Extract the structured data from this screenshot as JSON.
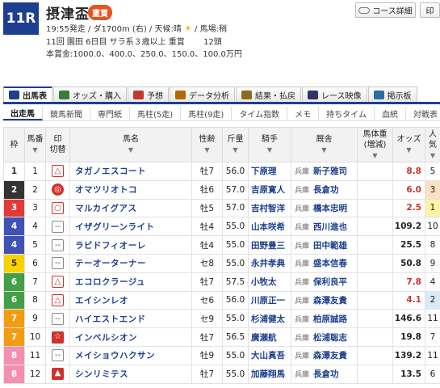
{
  "race": {
    "number": "11R",
    "name": "摂津盃",
    "grade": "重賞",
    "line1": "19:55発走 / ダ1700m (右) / 天候:晴 ",
    "weather_icon": "sun-icon",
    "line1b": " / 馬場:稍",
    "line2": "11回 園田 6日目 サラ系３歳以上 重賞 　　12頭",
    "line3": "本賞金:1000.0、400.0、250.0、150.0、100.0万円"
  },
  "buttons": {
    "course": "コース詳細",
    "print": "印"
  },
  "tabs": [
    {
      "label": "出馬表",
      "color": "#1d3f8f"
    },
    {
      "label": "オッズ・購入",
      "color": "#3a7a3a"
    },
    {
      "label": "予想",
      "color": "#c0392b"
    },
    {
      "label": "データ分析",
      "color": "#b36b00"
    },
    {
      "label": "結果・払戻",
      "color": "#8a6d1e"
    },
    {
      "label": "レース映像",
      "color": "#333366"
    },
    {
      "label": "掲示板",
      "color": "#2e6da4"
    }
  ],
  "subtabs": [
    "出走馬",
    "競馬新聞",
    "専門紙",
    "馬柱(5走)",
    "馬柱(9走)",
    "タイム指数",
    "メモ",
    "持ちタイム",
    "血統",
    "対戦表"
  ],
  "headers": {
    "waku": "枠",
    "umaban": "馬番",
    "mark": "印",
    "mark_sub": "切替",
    "horse": "馬名",
    "sex_age": "性齢",
    "weight": "斤量",
    "jockey": "騎手",
    "trainer": "厩舎",
    "body_weight": "馬体重",
    "body_weight_sub": "(増減)",
    "odds": "オッズ",
    "popularity": "人気",
    "sort_arrow": "▼"
  },
  "colors": {
    "waku1": "#ffffff",
    "waku2": "#333333",
    "waku3": "#e53935",
    "waku4": "#3f51b5",
    "waku5": "#f9d100",
    "waku6": "#43a047",
    "waku7": "#f39c12",
    "waku8": "#f48fb1"
  },
  "horses": [
    {
      "waku": "1",
      "umaban": "1",
      "mark": "△",
      "mark_type": "tri",
      "name": "タガノエスコート",
      "sex_age": "牡7",
      "weight": "56.0",
      "jockey": "下原理",
      "stable": "兵庫",
      "trainer": "新子雅司",
      "odds": "8.8",
      "odds_red": true,
      "pop": "5"
    },
    {
      "waku": "2",
      "umaban": "2",
      "mark": "◎",
      "mark_type": "dbl",
      "name": "オマツリオトコ",
      "sex_age": "牡6",
      "weight": "57.0",
      "jockey": "吉原寛人",
      "stable": "兵庫",
      "trainer": "長倉功",
      "odds": "6.0",
      "odds_red": true,
      "pop": "3"
    },
    {
      "waku": "3",
      "umaban": "3",
      "mark": "○",
      "mark_type": "circ",
      "name": "マルカイグアス",
      "sex_age": "牡5",
      "weight": "57.0",
      "jockey": "吉村智洋",
      "stable": "兵庫",
      "trainer": "橋本忠明",
      "odds": "2.5",
      "odds_red": true,
      "pop": "1"
    },
    {
      "waku": "4",
      "umaban": "4",
      "mark": "--",
      "mark_type": "dash",
      "name": "イザグリーンライト",
      "sex_age": "牡4",
      "weight": "55.0",
      "jockey": "山本咲希",
      "stable": "兵庫",
      "trainer": "西川進也",
      "odds": "109.2",
      "odds_red": false,
      "pop": "10"
    },
    {
      "waku": "4",
      "umaban": "5",
      "mark": "--",
      "mark_type": "dash",
      "name": "ラビドフィオーレ",
      "sex_age": "牡4",
      "weight": "55.0",
      "jockey": "田野豊三",
      "stable": "兵庫",
      "trainer": "田中範雄",
      "odds": "25.5",
      "odds_red": false,
      "pop": "8"
    },
    {
      "waku": "5",
      "umaban": "6",
      "mark": "--",
      "mark_type": "dash",
      "name": "テーオーターナー",
      "sex_age": "セ8",
      "weight": "55.0",
      "jockey": "永井孝典",
      "stable": "兵庫",
      "trainer": "盛本信春",
      "odds": "50.8",
      "odds_red": false,
      "pop": "9"
    },
    {
      "waku": "6",
      "umaban": "7",
      "mark": "△",
      "mark_type": "tri",
      "name": "エコロクラージュ",
      "sex_age": "牡7",
      "weight": "57.5",
      "jockey": "小牧太",
      "stable": "兵庫",
      "trainer": "保利良平",
      "odds": "7.8",
      "odds_red": true,
      "pop": "4"
    },
    {
      "waku": "6",
      "umaban": "8",
      "mark": "△",
      "mark_type": "tri",
      "name": "エイシンレオ",
      "sex_age": "セ6",
      "weight": "56.0",
      "jockey": "川原正一",
      "stable": "兵庫",
      "trainer": "森澤友貴",
      "odds": "4.1",
      "odds_red": true,
      "pop": "2"
    },
    {
      "waku": "7",
      "umaban": "9",
      "mark": "--",
      "mark_type": "dash",
      "name": "ハイエストエンド",
      "sex_age": "セ9",
      "weight": "55.0",
      "jockey": "杉浦健太",
      "stable": "兵庫",
      "trainer": "柏原誠路",
      "odds": "146.6",
      "odds_red": false,
      "pop": "11"
    },
    {
      "waku": "7",
      "umaban": "10",
      "mark": "☆",
      "mark_type": "star",
      "name": "インベルシオン",
      "sex_age": "牡7",
      "weight": "56.5",
      "jockey": "廣瀬航",
      "stable": "兵庫",
      "trainer": "松浦聡志",
      "odds": "19.8",
      "odds_red": false,
      "pop": "7"
    },
    {
      "waku": "8",
      "umaban": "11",
      "mark": "--",
      "mark_type": "dash",
      "name": "メイショウハクサン",
      "sex_age": "牡9",
      "weight": "55.0",
      "jockey": "大山真吾",
      "stable": "兵庫",
      "trainer": "森澤友貴",
      "odds": "139.2",
      "odds_red": false,
      "pop": "11"
    },
    {
      "waku": "8",
      "umaban": "12",
      "mark": "▲",
      "mark_type": "tri-fill",
      "name": "シンリミテス",
      "sex_age": "牡7",
      "weight": "55.0",
      "jockey": "加藤翔馬",
      "stable": "兵庫",
      "trainer": "長倉功",
      "odds": "13.5",
      "odds_red": false,
      "pop": "6"
    }
  ]
}
